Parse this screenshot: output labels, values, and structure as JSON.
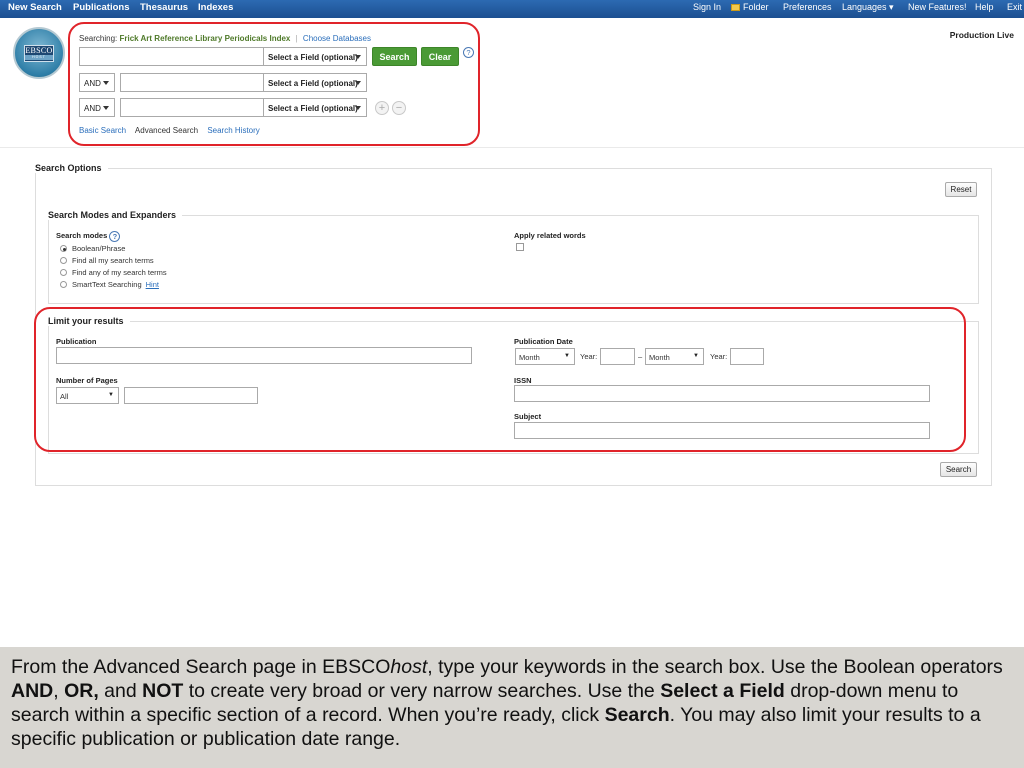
{
  "topbar": {
    "left": [
      "New Search",
      "Publications",
      "Thesaurus",
      "Indexes"
    ],
    "right": [
      "Sign In",
      "Folder",
      "Preferences",
      "Languages ▾",
      "New Features!",
      "Help",
      "Exit"
    ]
  },
  "logo": {
    "line1": "EBSCO",
    "line2": "HOST"
  },
  "production": "Production Live",
  "search": {
    "searching_label": "Searching:",
    "database": "Frick Art Reference Library Periodicals Index",
    "choose_databases": "Choose Databases",
    "field_label": "Select a Field (optional)",
    "bool_value": "AND",
    "search_btn": "Search",
    "clear_btn": "Clear",
    "help": "?",
    "add": "+",
    "remove": "−",
    "links": {
      "basic": "Basic Search",
      "advanced": "Advanced Search",
      "history": "Search History"
    }
  },
  "options": {
    "title": "Search Options",
    "reset": "Reset",
    "modes_title": "Search Modes and Expanders",
    "modes_label": "Search modes",
    "modes_help": "?",
    "modes": [
      "Boolean/Phrase",
      "Find all my search terms",
      "Find any of my search terms",
      "SmartText Searching"
    ],
    "hint": "Hint",
    "related_label": "Apply related words",
    "limit_title": "Limit your results",
    "publication_label": "Publication",
    "pages_label": "Number of Pages",
    "pages_select": "All",
    "pubdate_label": "Publication Date",
    "month": "Month",
    "year": "Year:",
    "dash": "–",
    "issn_label": "ISSN",
    "subject_label": "Subject",
    "bottom_search": "Search"
  },
  "caption": {
    "p1": "From the Advanced Search page in EBSCO",
    "p1i": "host",
    "p2": ", type your keywords in the search box. Use the Boolean operators ",
    "and": "AND",
    "c1": ", ",
    "or": "OR,",
    "c2": " and ",
    "not": "NOT",
    "p3": " to create very broad or very narrow searches. Use the ",
    "field": "Select a Field",
    "p4": " drop-down menu to search within a specific section of a record. When you’re ready, click ",
    "search": "Search",
    "p5": ". You may also limit your results to a specific publication or publication date range."
  }
}
